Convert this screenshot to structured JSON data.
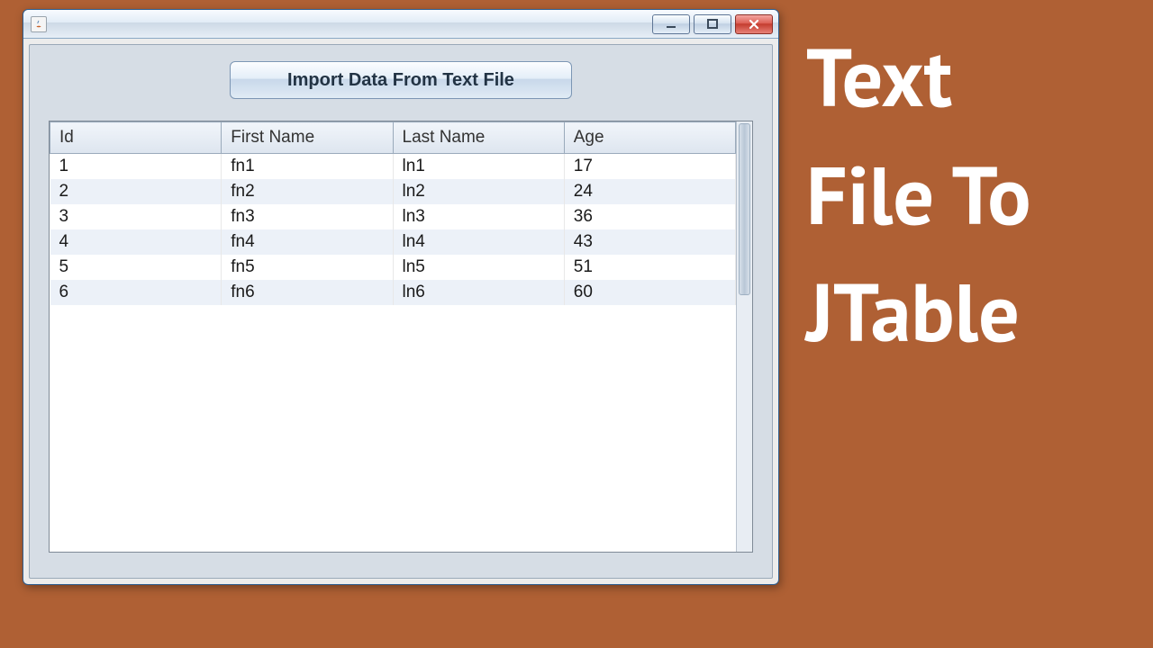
{
  "window": {
    "button_label": "Import Data From Text File"
  },
  "table": {
    "columns": [
      "Id",
      "First Name",
      "Last Name",
      "Age"
    ],
    "rows": [
      {
        "id": "1",
        "first": "fn1",
        "last": "ln1",
        "age": "17"
      },
      {
        "id": "2",
        "first": "fn2",
        "last": "ln2",
        "age": "24"
      },
      {
        "id": "3",
        "first": "fn3",
        "last": "ln3",
        "age": "36"
      },
      {
        "id": "4",
        "first": "fn4",
        "last": "ln4",
        "age": "43"
      },
      {
        "id": "5",
        "first": "fn5",
        "last": "ln5",
        "age": "51"
      },
      {
        "id": "6",
        "first": "fn6",
        "last": "ln6",
        "age": "60"
      }
    ]
  },
  "caption": {
    "line1": "Text",
    "line2": "File To",
    "line3": "JTable"
  }
}
